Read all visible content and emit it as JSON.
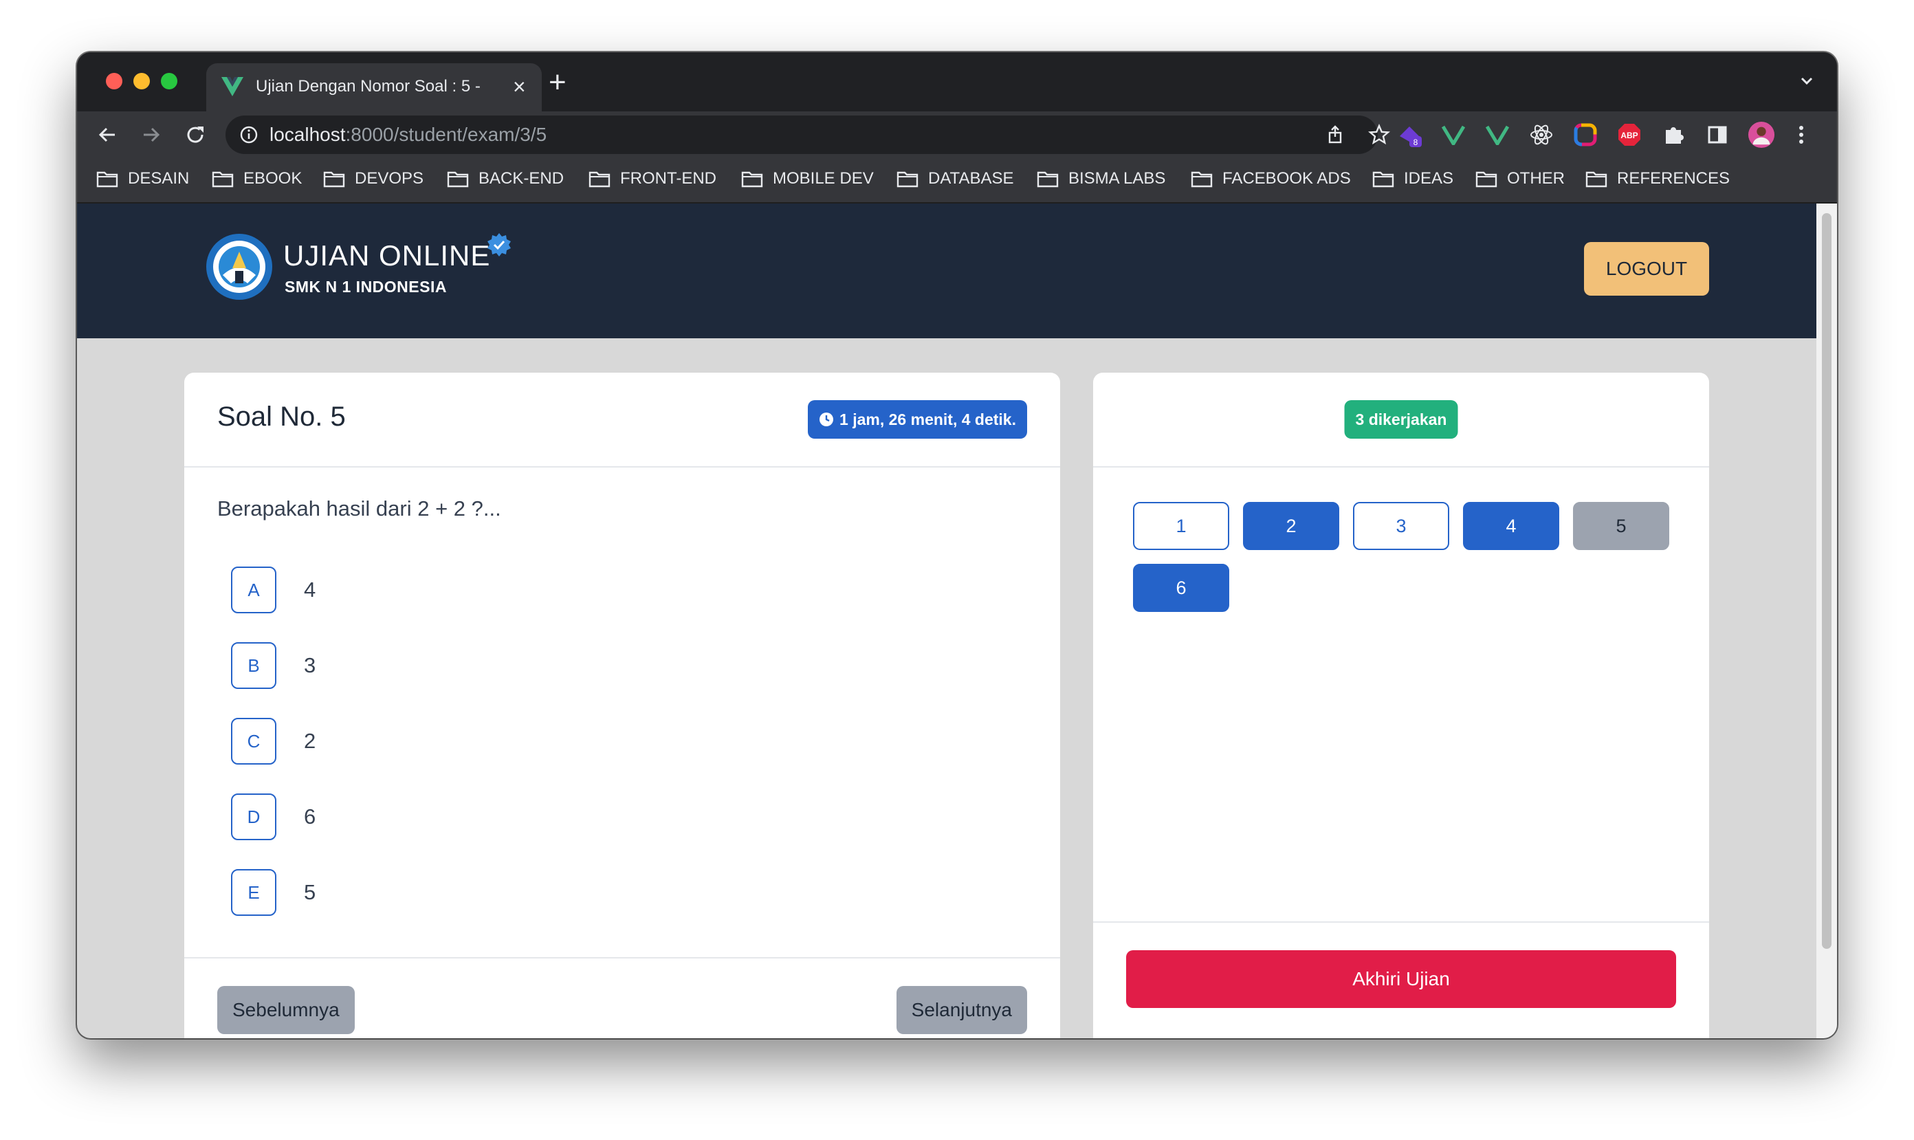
{
  "browser": {
    "tab": {
      "title": "Ujian Dengan Nomor Soal : 5 -",
      "favicon": "vue-icon"
    },
    "url": {
      "host": "localhost",
      "path": ":8000/student/exam/3/5"
    },
    "extensions": [
      {
        "name": "extension-badge-icon",
        "badge": "8"
      },
      {
        "name": "vue-devtools-icon"
      },
      {
        "name": "vue-devtools-icon"
      },
      {
        "name": "react-devtools-icon"
      },
      {
        "name": "color-picker-icon"
      },
      {
        "name": "adblock-plus-icon",
        "label": "ABP"
      },
      {
        "name": "extensions-puzzle-icon"
      },
      {
        "name": "side-panel-icon"
      },
      {
        "name": "profile-avatar-icon"
      },
      {
        "name": "more-menu-icon"
      }
    ],
    "bookmarks": [
      "DESAIN",
      "EBOOK",
      "DEVOPS",
      "BACK-END",
      "FRONT-END",
      "MOBILE DEV",
      "DATABASE",
      "BISMA LABS",
      "FACEBOOK ADS",
      "IDEAS",
      "OTHER",
      "REFERENCES"
    ]
  },
  "header": {
    "title": "UJIAN ONLINE",
    "subtitle": "SMK N 1 INDONESIA",
    "logout_label": "LOGOUT"
  },
  "question_card": {
    "title": "Soal No. 5",
    "timer": "1 jam, 26 menit, 4 detik.",
    "question": "Berapakah hasil dari 2 + 2 ?...",
    "options": [
      {
        "letter": "A",
        "text": "4"
      },
      {
        "letter": "B",
        "text": "3"
      },
      {
        "letter": "C",
        "text": "2"
      },
      {
        "letter": "D",
        "text": "6"
      },
      {
        "letter": "E",
        "text": "5"
      }
    ],
    "prev_label": "Sebelumnya",
    "next_label": "Selanjutnya"
  },
  "nav_card": {
    "answered_badge": "3 dikerjakan",
    "numbers": [
      {
        "label": "1",
        "state": "unanswered"
      },
      {
        "label": "2",
        "state": "answered"
      },
      {
        "label": "3",
        "state": "unanswered"
      },
      {
        "label": "4",
        "state": "answered"
      },
      {
        "label": "5",
        "state": "current"
      },
      {
        "label": "6",
        "state": "answered"
      }
    ],
    "finish_label": "Akhiri Ujian"
  },
  "colors": {
    "navbar": "#1e293b",
    "primary": "#2563c9",
    "success": "#22b07d",
    "danger": "#e11d48",
    "logout": "#f2c078",
    "muted": "#9ca3af"
  }
}
